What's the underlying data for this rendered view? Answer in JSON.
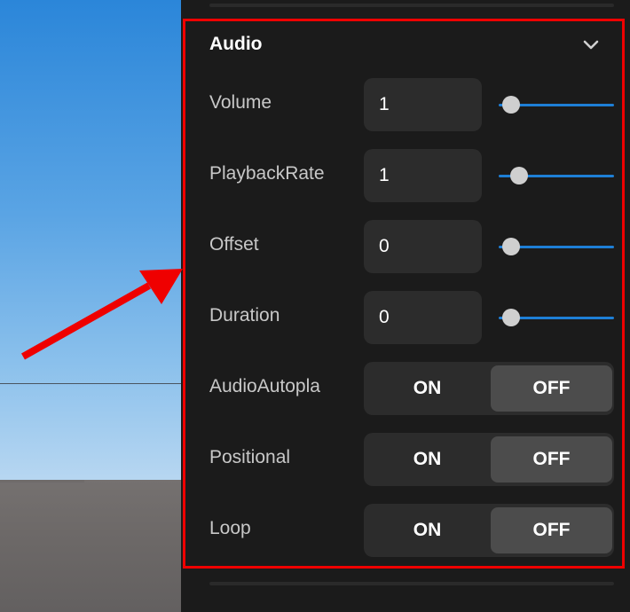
{
  "audio": {
    "title": "Audio",
    "chevron_icon": "chevron-down-icon",
    "volume": {
      "label": "Volume",
      "value": "1",
      "slider_fraction": 0.07
    },
    "playback_rate": {
      "label": "PlaybackRate",
      "value": "1",
      "slider_fraction": 0.14
    },
    "offset": {
      "label": "Offset",
      "value": "0",
      "slider_fraction": 0.07
    },
    "duration": {
      "label": "Duration",
      "value": "0",
      "slider_fraction": 0.07
    },
    "audio_autoplay": {
      "label": "AudioAutopla",
      "on_label": "ON",
      "off_label": "OFF",
      "selected": "OFF"
    },
    "positional": {
      "label": "Positional",
      "on_label": "ON",
      "off_label": "OFF",
      "selected": "OFF"
    },
    "loop": {
      "label": "Loop",
      "on_label": "ON",
      "off_label": "OFF",
      "selected": "OFF"
    }
  },
  "colors": {
    "panel_bg": "#1b1b1b",
    "input_bg": "#2c2c2c",
    "slider_accent": "#1e7fd6",
    "highlight_border": "#ef0000",
    "annotation_arrow": "#ef0000"
  }
}
